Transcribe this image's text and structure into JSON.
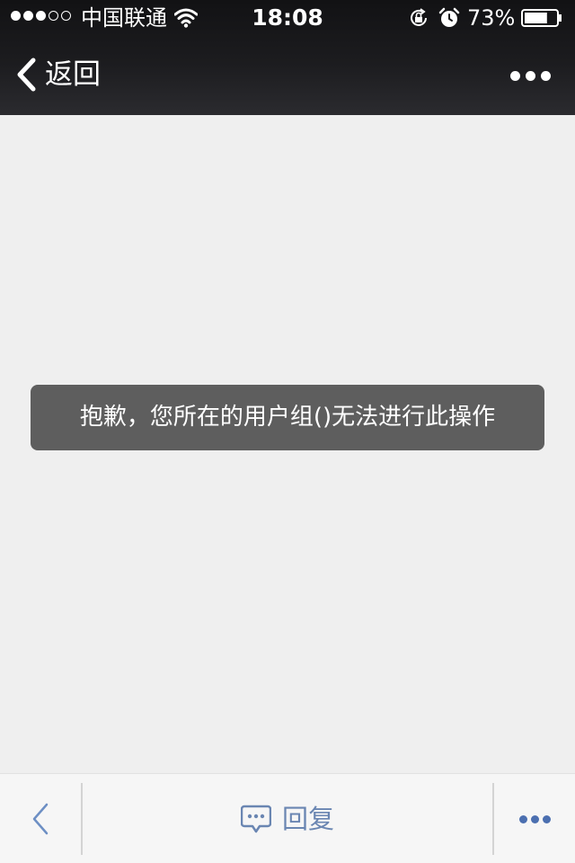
{
  "status_bar": {
    "carrier": "中国联通",
    "time": "18:08",
    "battery_percent": "73%",
    "battery_level": 0.73,
    "signal_strength": 3,
    "signal_max": 5
  },
  "nav_bar": {
    "back_label": "返回",
    "more_icon": "more-horizontal-icon"
  },
  "toast": {
    "message": "抱歉，您所在的用户组()无法进行此操作"
  },
  "bottom_toolbar": {
    "back_icon": "chevron-left-icon",
    "reply_icon": "comment-icon",
    "reply_label": "回复",
    "more_icon": "more-horizontal-icon",
    "accent_color": "#4b6fb0"
  }
}
